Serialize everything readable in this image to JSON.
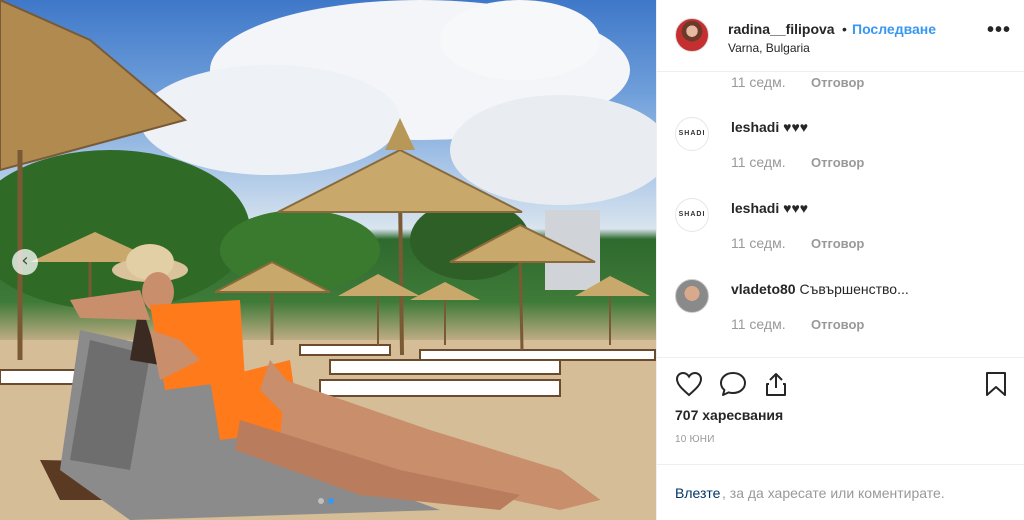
{
  "post": {
    "username": "radina__filipova",
    "separator": "•",
    "follow_label": "Последване",
    "location": "Varna, Bulgaria",
    "more_icon": "more-options-icon",
    "more_glyph": "•••"
  },
  "photo": {
    "nav_glyph": "‹",
    "carousel_count": 2,
    "carousel_active": 2
  },
  "comments": {
    "first_meta": {
      "time": "11 седм.",
      "reply": "Отговор"
    },
    "items": [
      {
        "avatar_text": "SHADI",
        "username": "leshadi",
        "text": "♥♥♥",
        "time": "11 седм.",
        "reply": "Отговор"
      },
      {
        "avatar_text": "SHADI",
        "username": "leshadi",
        "text": "♥♥♥",
        "time": "11 седм.",
        "reply": "Отговор"
      },
      {
        "avatar_text": "",
        "username": "vladeto80",
        "text": "Съвършенство...",
        "time": "11 седм.",
        "reply": "Отговор"
      }
    ]
  },
  "actions": {
    "likes": "707 харесвания",
    "date": "10 ЮНИ",
    "icons": [
      "heart-icon",
      "comment-icon",
      "share-icon",
      "bookmark-icon"
    ]
  },
  "login": {
    "link": "Влезте",
    "rest": ", за да харесате или коментирате."
  },
  "colors": {
    "link_blue": "#3897f0",
    "muted": "#999999",
    "text": "#262626"
  }
}
